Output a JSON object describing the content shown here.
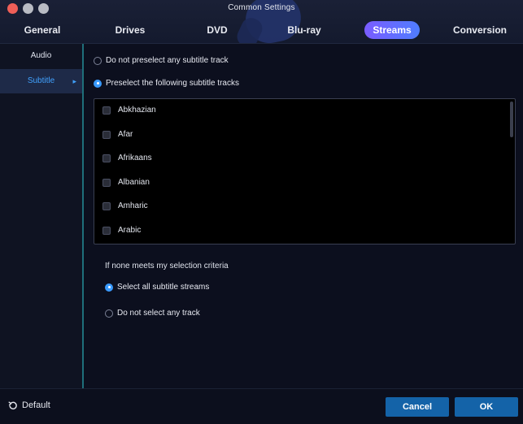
{
  "window": {
    "title": "Common Settings",
    "controls": [
      "close",
      "minimize",
      "zoom"
    ]
  },
  "tabs": [
    {
      "label": "General"
    },
    {
      "label": "Drives"
    },
    {
      "label": "DVD"
    },
    {
      "label": "Blu-ray"
    },
    {
      "label": "Streams",
      "active": true
    },
    {
      "label": "Conversion"
    }
  ],
  "sidebar": {
    "items": [
      {
        "label": "Audio"
      },
      {
        "label": "Subtitle",
        "active": true
      }
    ]
  },
  "main": {
    "preselect": {
      "option_none": "Do not preselect any subtitle track",
      "option_following": "Preselect the following subtitle tracks",
      "selected": "following"
    },
    "languages": [
      {
        "label": "Abkhazian",
        "checked": false
      },
      {
        "label": "Afar",
        "checked": false
      },
      {
        "label": "Afrikaans",
        "checked": false
      },
      {
        "label": "Albanian",
        "checked": false
      },
      {
        "label": "Amharic",
        "checked": false
      },
      {
        "label": "Arabic",
        "checked": false
      }
    ],
    "fallback": {
      "heading": "If none meets my selection criteria",
      "option_all": "Select all subtitle streams",
      "option_none": "Do not select any track",
      "selected": "all"
    }
  },
  "footer": {
    "default_label": "Default",
    "cancel_label": "Cancel",
    "ok_label": "OK"
  },
  "colors": {
    "accent": "#3a9bff",
    "tab_active_start": "#7a5cff",
    "tab_active_end": "#4f7dff",
    "button": "#1463a8",
    "sidebar_divider": "#1f6f7a"
  },
  "icons": {
    "default": "reset-icon",
    "sidebar_active": "chevron-right-icon"
  }
}
